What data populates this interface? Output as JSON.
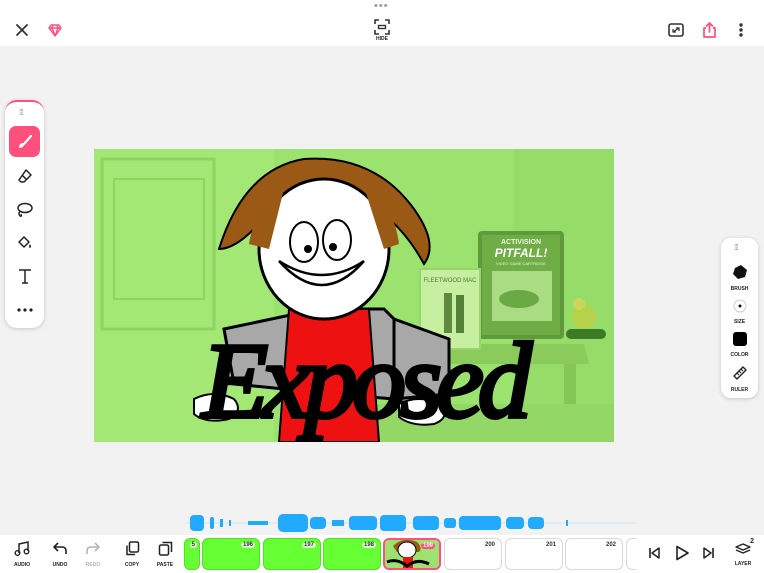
{
  "top_bar": {
    "hide_label": "HIDE",
    "icons": [
      "close-icon",
      "gem-icon",
      "hide-icon",
      "resize-icon",
      "share-icon",
      "more-icon"
    ]
  },
  "artwork": {
    "caption": "Exposed",
    "poster_brand": "ACTIVISION",
    "poster_title": "PITFALL!",
    "poster_subtitle": "VIDEO GAME CARTRIDGE",
    "record_title": "FLEETWOOD MAC",
    "color_tint": "#9be26e"
  },
  "toolbox": {
    "active_tool": "brush",
    "tools": [
      "brush",
      "eraser",
      "lasso",
      "fill",
      "text",
      "more"
    ]
  },
  "right_panel": {
    "brush_label": "BRUSH",
    "size_label": "SIZE",
    "color_label": "COLOR",
    "ruler_label": "RULER",
    "current_color": "#000000"
  },
  "bottom_bar": {
    "audio_label": "AUDIO",
    "undo_label": "UNDO",
    "redo_label": "REDO",
    "copy_label": "COPY",
    "paste_label": "PASTE",
    "layer_label": "LAYER",
    "layer_count": "2"
  },
  "timeline": {
    "partial_frame": "5",
    "frames": [
      {
        "number": "196",
        "state": "green"
      },
      {
        "number": "197",
        "state": "green"
      },
      {
        "number": "198",
        "state": "green"
      },
      {
        "number": "199",
        "state": "current"
      },
      {
        "number": "200",
        "state": "empty"
      },
      {
        "number": "201",
        "state": "empty"
      },
      {
        "number": "202",
        "state": "empty"
      }
    ],
    "waveform_color": "#22aaff"
  },
  "colors": {
    "accent": "#ff4f7c",
    "green_frame": "#66ff33"
  }
}
